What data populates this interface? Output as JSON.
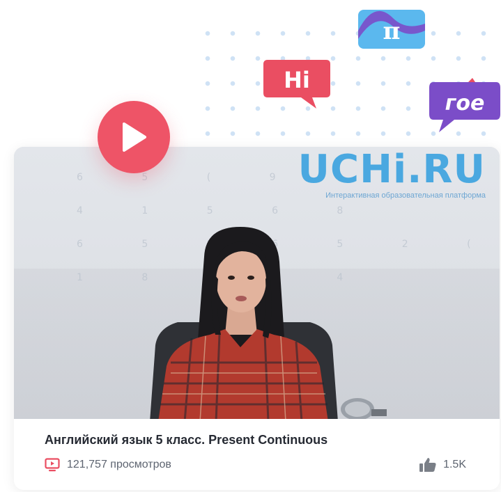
{
  "stickers": {
    "pi_text": "π",
    "hi_text": "Hi",
    "goe_text": "гое"
  },
  "video": {
    "brand_logo": "UCHi.RU",
    "brand_tagline": "Интерактивная образовательная платформа",
    "wall_digits": "6 5 ( 9\n4 1 5 6 8\n6 5 8 6 5 2 ( 9\n1 8 6 5 4",
    "title": "Английский язык 5 класс. Present Continuous",
    "views": "121,757 просмотров",
    "likes": "1.5K"
  },
  "colors": {
    "play": "#ee5467",
    "accent_red": "#ea4e62",
    "brand_blue": "#4aa8e0",
    "purple": "#7b4dc8",
    "sky": "#5bb8ee"
  },
  "icons": {
    "play": "play-icon",
    "views": "video-views-icon",
    "likes": "thumbs-up-icon"
  }
}
